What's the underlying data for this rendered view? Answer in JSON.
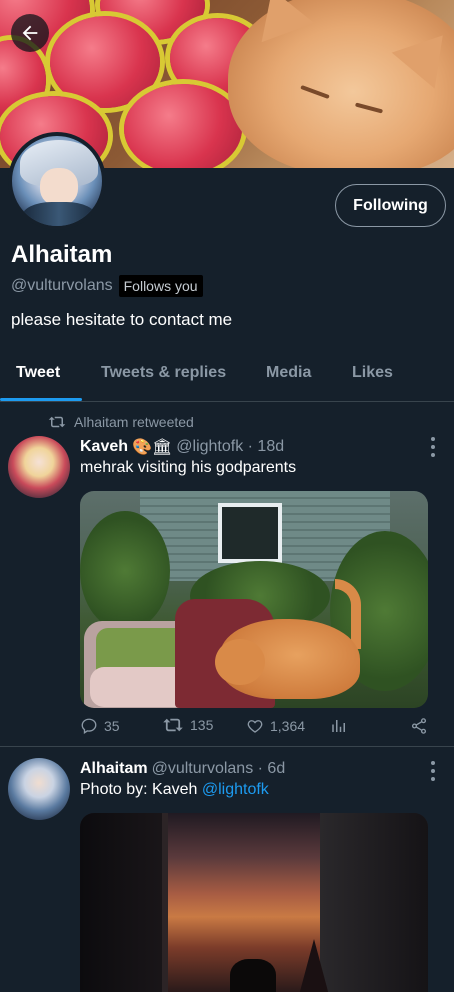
{
  "profile": {
    "name": "Alhaitam",
    "handle": "@vulturvolans",
    "follows_you": "Follows you",
    "bio": "please hesitate to contact me",
    "following_button": "Following"
  },
  "tabs": [
    {
      "label": "Tweet",
      "active": true
    },
    {
      "label": "Tweets & replies",
      "active": false
    },
    {
      "label": "Media",
      "active": false
    },
    {
      "label": "Likes",
      "active": false
    }
  ],
  "tweets": [
    {
      "retweet_note": "Alhaitam retweeted",
      "name": "Kaveh",
      "emoji": "🎨🏛",
      "handle_time": "@lightofk · 18d",
      "text": "mehrak visiting his godparents",
      "replies": "35",
      "retweets": "135",
      "likes": "1,364"
    },
    {
      "name": "Alhaitam",
      "handle_time": "@vulturvolans · 6d",
      "text_prefix": "Photo by: Kaveh ",
      "mention": "@lightofk"
    }
  ],
  "colors": {
    "background": "#15202b",
    "accent": "#1d9bf0",
    "muted": "#8b98a5",
    "divider": "#38444d"
  },
  "icons": [
    "back-arrow-icon",
    "retweet-icon",
    "reply-icon",
    "like-icon",
    "analytics-icon",
    "share-icon",
    "more-icon"
  ]
}
